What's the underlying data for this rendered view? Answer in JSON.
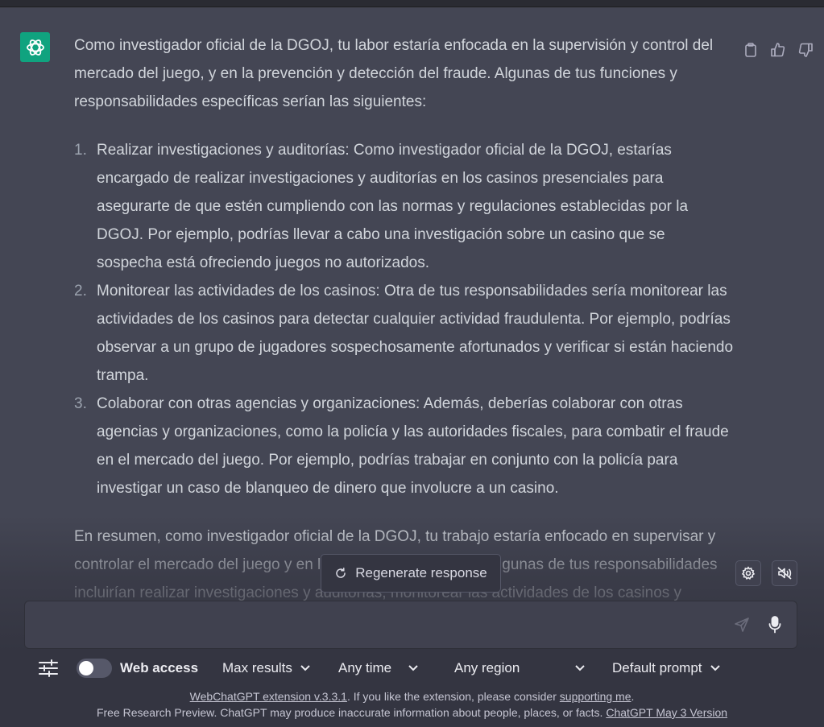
{
  "response": {
    "intro": "Como investigador oficial de la DGOJ, tu labor estaría enfocada en la supervisión y control del mercado del juego, y en la prevención y detección del fraude. Algunas de tus funciones y responsabilidades específicas serían las siguientes:",
    "items": [
      {
        "num": "1.",
        "text": "Realizar investigaciones y auditorías: Como investigador oficial de la DGOJ, estarías encargado de realizar investigaciones y auditorías en los casinos presenciales para asegurarte de que estén cumpliendo con las normas y regulaciones establecidas por la DGOJ. Por ejemplo, podrías llevar a cabo una investigación sobre un casino que se sospecha está ofreciendo juegos no autorizados."
      },
      {
        "num": "2.",
        "text": "Monitorear las actividades de los casinos: Otra de tus responsabilidades sería monitorear las actividades de los casinos para detectar cualquier actividad fraudulenta. Por ejemplo, podrías observar a un grupo de jugadores sospechosamente afortunados y verificar si están haciendo trampa."
      },
      {
        "num": "3.",
        "text": "Colaborar con otras agencias y organizaciones: Además, deberías colaborar con otras agencias y organizaciones, como la policía y las autoridades fiscales, para combatir el fraude en el mercado del juego. Por ejemplo, podrías trabajar en conjunto con la policía para investigar un caso de blanqueo de dinero que involucre a un casino."
      }
    ],
    "summary": "En resumen, como investigador oficial de la DGOJ, tu trabajo estaría enfocado en supervisar y controlar el mercado del juego y en la prevención del fraude. Algunas de tus responsabilidades incluirían realizar investigaciones y auditorías, monitorear las actividades de los casinos y"
  },
  "regenerate_label": "Regenerate response",
  "composer": {
    "placeholder": ""
  },
  "toolbar": {
    "web_access_label": "Web access",
    "web_access_on": false,
    "max_results": "Max results",
    "time": "Any time",
    "region": "Any region",
    "prompt": "Default prompt"
  },
  "footer": {
    "extension_link": "WebChatGPT extension v.3.3.1",
    "extension_text": ". If you like the extension, please consider ",
    "support_link": "supporting me",
    "support_end": ".",
    "disclaimer": "Free Research Preview. ChatGPT may produce inaccurate information about people, places, or facts. ",
    "version_link": "ChatGPT May 3 Version"
  },
  "colors": {
    "accent": "#10a37f",
    "background": "#343541",
    "message_bg": "#444654"
  }
}
